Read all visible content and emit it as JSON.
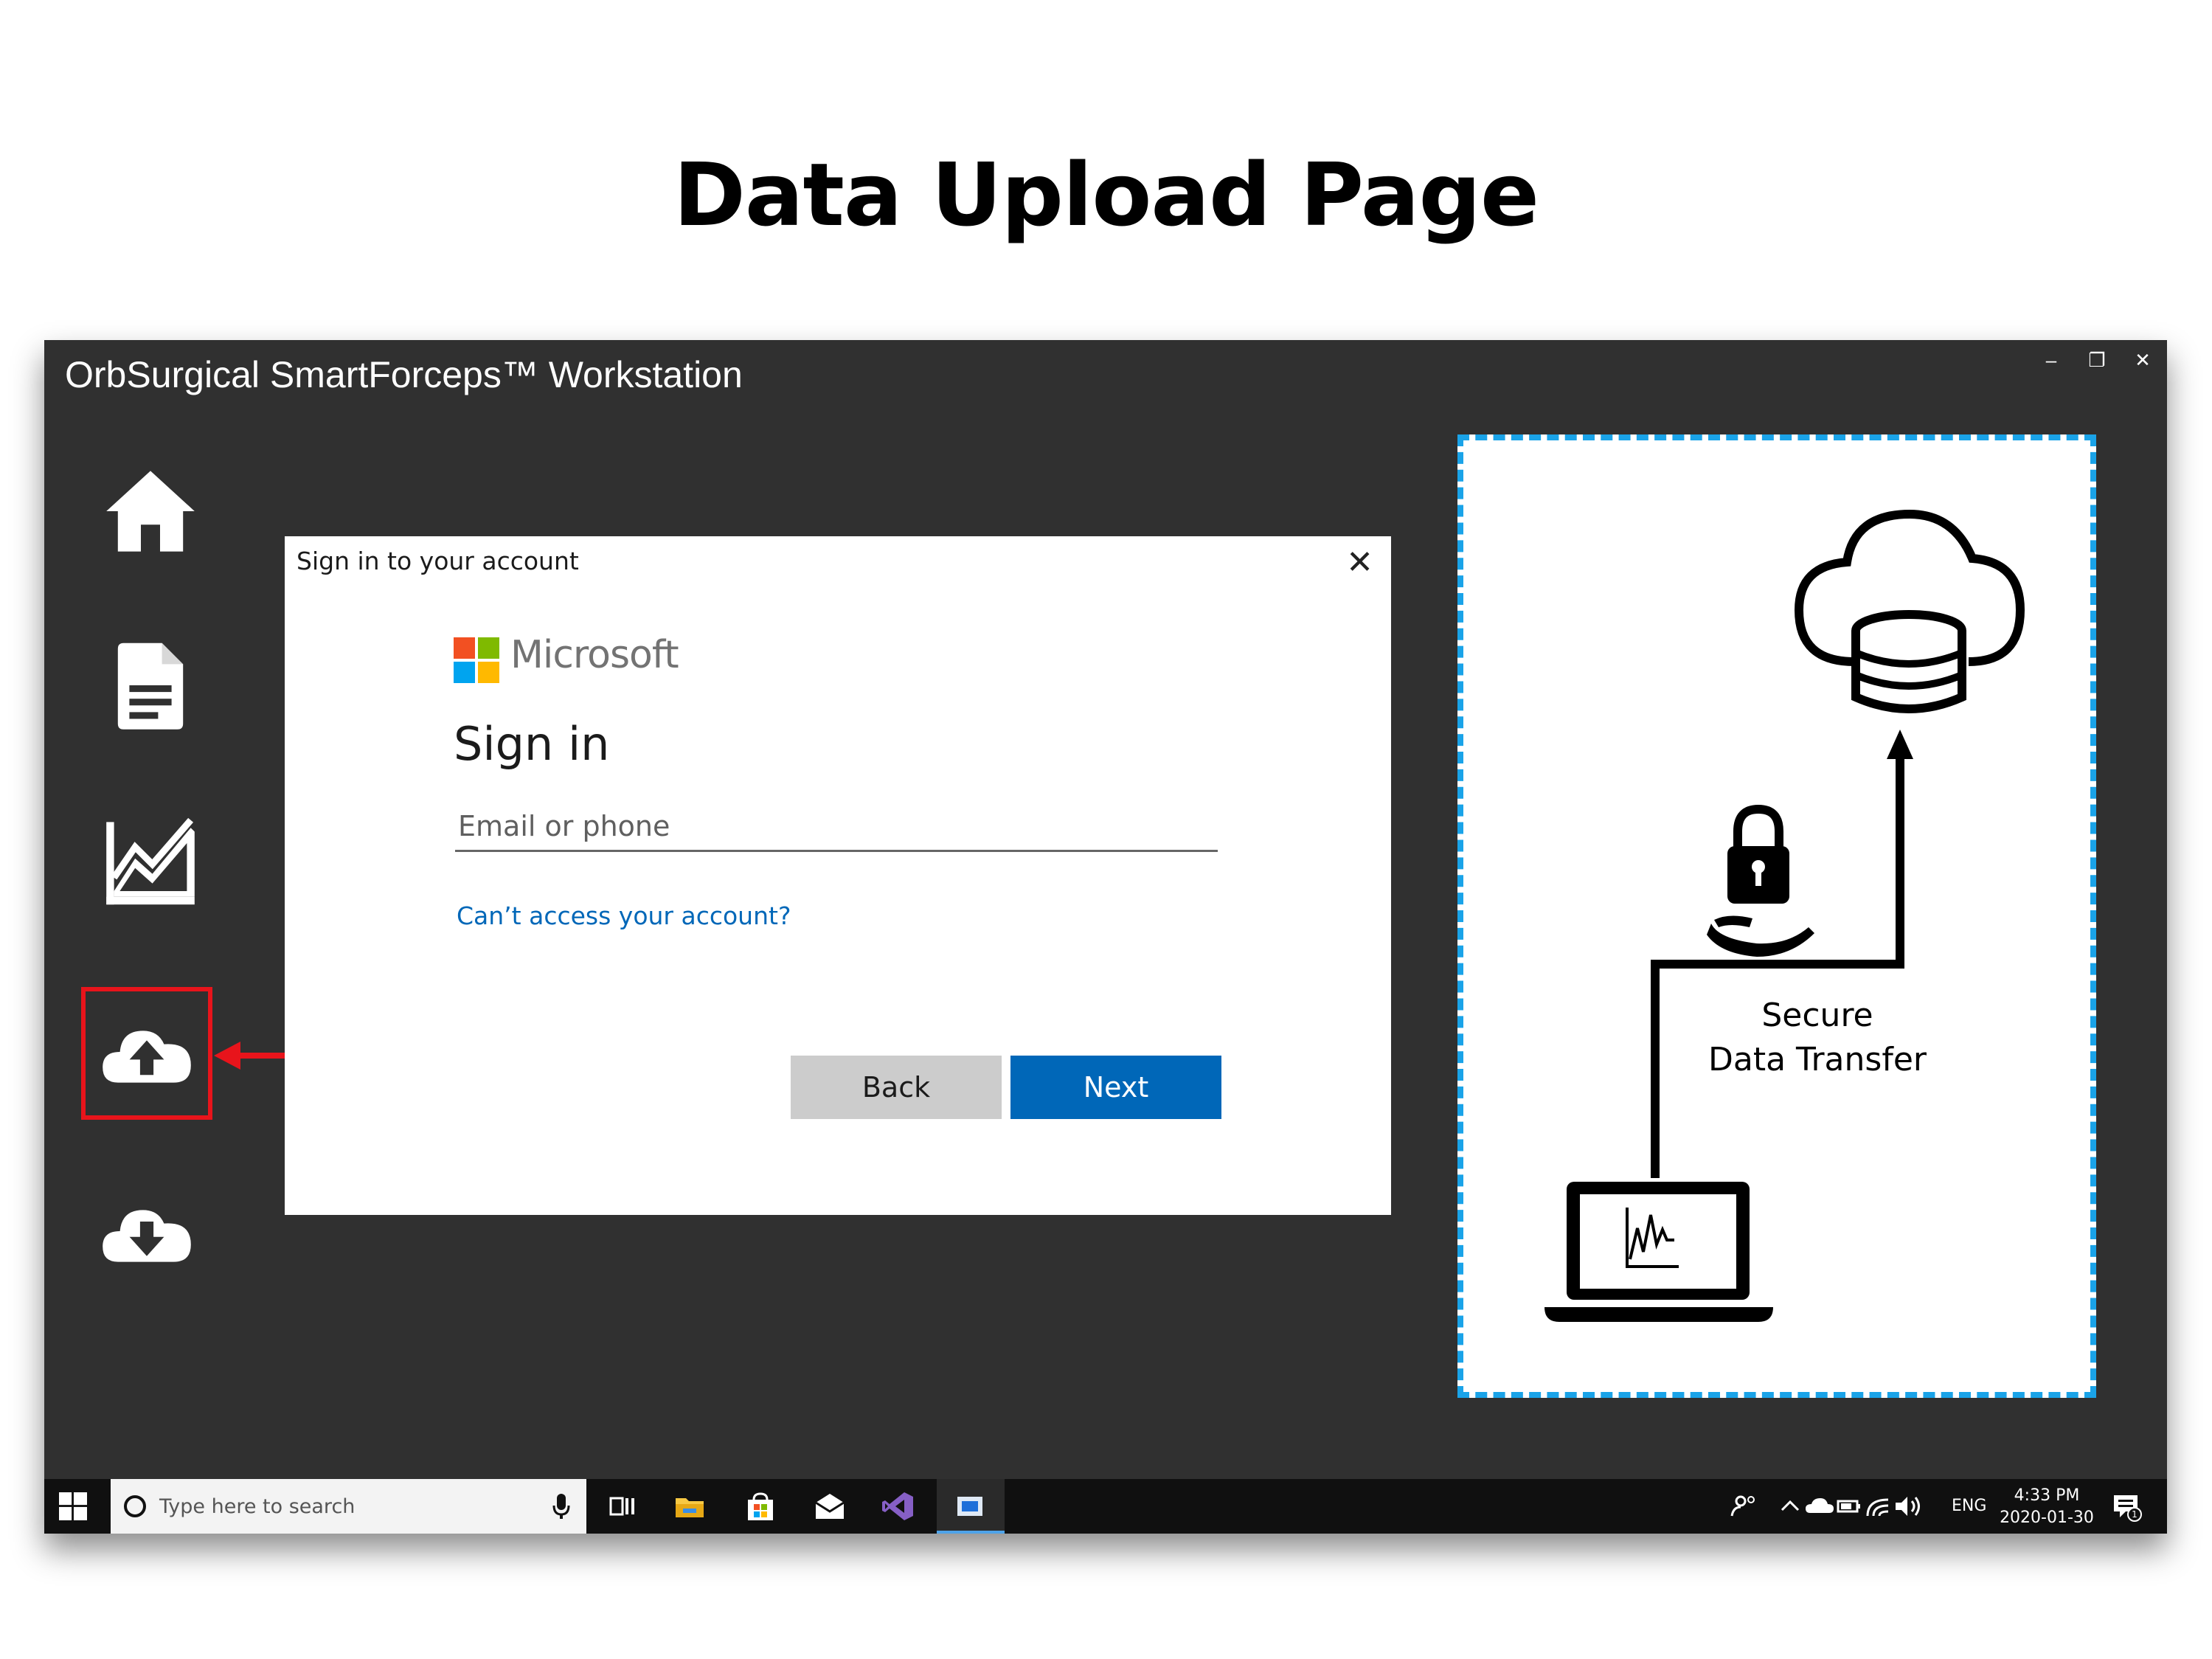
{
  "slide": {
    "title": "Data Upload Page"
  },
  "window": {
    "title": "OrbSurgical SmartForceps™ Workstation",
    "controls": {
      "minimize": "–",
      "restore": "❐",
      "close": "✕"
    }
  },
  "sidebar": {
    "items": [
      {
        "name": "home",
        "icon": "home-icon"
      },
      {
        "name": "report",
        "icon": "document-icon"
      },
      {
        "name": "analytics",
        "icon": "chart-icon"
      },
      {
        "name": "upload",
        "icon": "cloud-upload-icon",
        "active": true
      },
      {
        "name": "download",
        "icon": "cloud-download-icon"
      }
    ],
    "highlight_color": "#e8141b"
  },
  "signin_dialog": {
    "header": "Sign in to your account",
    "close": "✕",
    "brand": "Microsoft",
    "heading": "Sign in",
    "email_placeholder": "Email or phone",
    "email_value": "",
    "cant_access": "Can’t access your account?",
    "back_label": "Back",
    "next_label": "Next",
    "accent": "#0067b8"
  },
  "illustration": {
    "label_line1": "Secure",
    "label_line2": "Data Transfer",
    "border_color": "#1aa3e8",
    "icons": [
      "cloud-database-icon",
      "lock-hand-icon",
      "laptop-signal-icon"
    ]
  },
  "taskbar": {
    "search_placeholder": "Type here to search",
    "language": "ENG",
    "time": "4:33 PM",
    "date": "2020-01-30",
    "notification_count": "1"
  }
}
